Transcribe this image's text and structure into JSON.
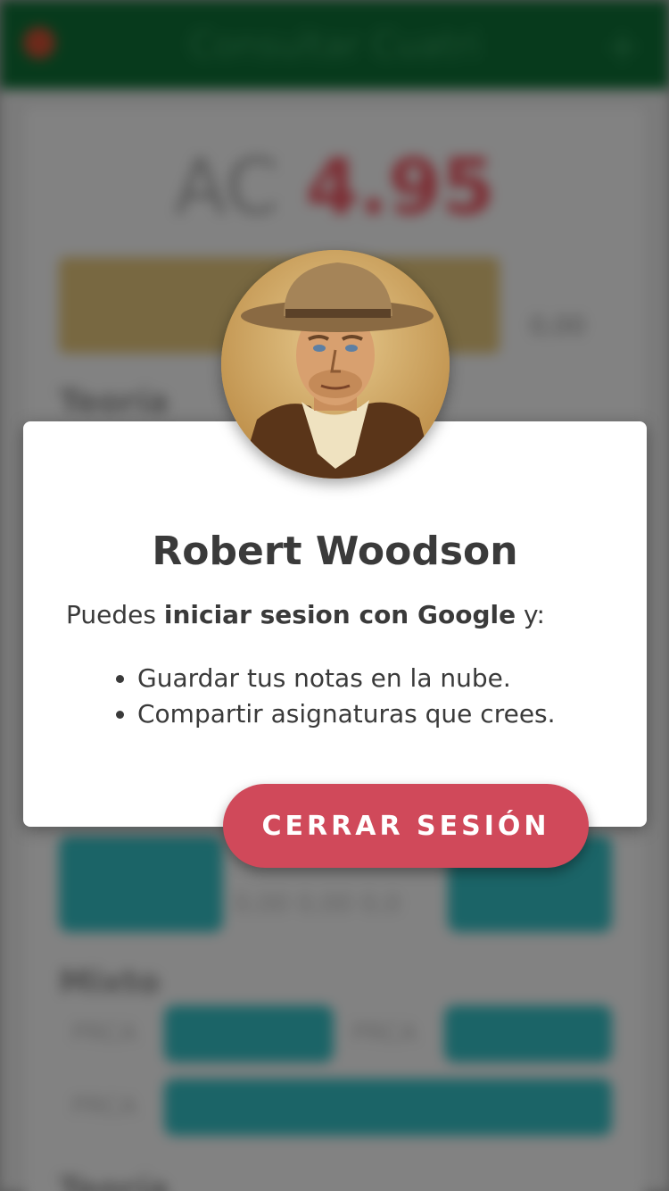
{
  "background": {
    "app_title": "Consultar Cuatri",
    "add_symbol": "+",
    "average_label": "AC",
    "average_value": "4.95",
    "gold_side_label": "0,00",
    "section_1": "Teoría",
    "section_2": "Mixto",
    "section_3": "Teoría",
    "stat_values": "0,00  0,00  0,0",
    "row_label_1": "PRCA",
    "row_label_2": "PRCA",
    "row_label_3": "PRCA"
  },
  "dialog": {
    "user_name": "Robert Woodson",
    "intro_prefix": "Puedes ",
    "intro_bold": "iniciar sesion con Google",
    "intro_suffix": " y:",
    "benefits": [
      "Guardar tus notas en la nube.",
      "Compartir asignaturas que crees."
    ],
    "logout_label": "CERRAR SESIÓN"
  },
  "colors": {
    "appbar": "#0c5a2c",
    "accent_red": "#d0495a",
    "teal": "#2a9a9e",
    "gold": "#b9a064"
  },
  "icons": {
    "menu": "menu-icon",
    "add": "plus-icon"
  }
}
